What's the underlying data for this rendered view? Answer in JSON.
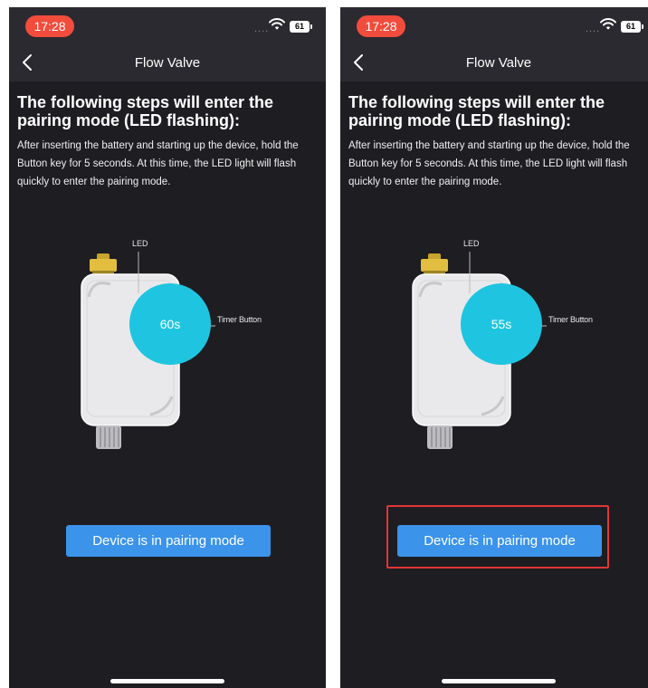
{
  "screens": [
    {
      "status": {
        "time": "17:28",
        "signal": "....",
        "battery": "61"
      },
      "nav": {
        "title": "Flow Valve",
        "back_icon": "chevron-left-icon"
      },
      "heading": "The following steps will enter the pairing mode (LED flashing):",
      "description": "After inserting the battery and starting up the device, hold the Button key for 5 seconds. At this time, the LED light will flash quickly to enter the pairing mode.",
      "illustration": {
        "led_label": "LED",
        "timer_button_label": "Timer Button",
        "countdown": "60s"
      },
      "pair_button_label": "Device is in pairing mode",
      "highlighted": false
    },
    {
      "status": {
        "time": "17:28",
        "signal": "....",
        "battery": "61"
      },
      "nav": {
        "title": "Flow Valve",
        "back_icon": "chevron-left-icon"
      },
      "heading": "The following steps will enter the pairing mode (LED flashing):",
      "description": "After inserting the battery and starting up the device, hold the Button key for 5 seconds. At this time, the LED light will flash quickly to enter the pairing mode.",
      "illustration": {
        "led_label": "LED",
        "timer_button_label": "Timer Button",
        "countdown": "55s"
      },
      "pair_button_label": "Device is in pairing mode",
      "highlighted": true
    }
  ],
  "colors": {
    "background": "#1d1d22",
    "bar": "#2a2a30",
    "time_pill": "#f24c3d",
    "countdown_circle": "#1fc5e0",
    "button": "#3b93ea",
    "highlight_box": "#e33535"
  }
}
